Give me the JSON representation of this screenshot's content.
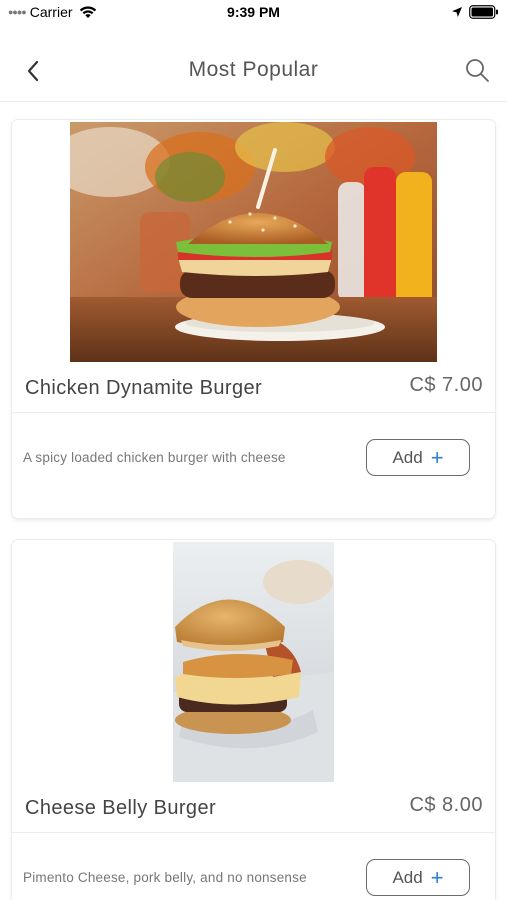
{
  "status_bar": {
    "carrier": "Carrier",
    "time": "9:39 PM",
    "icons": [
      "signal-dots-icon",
      "wifi-icon",
      "location-arrow-icon",
      "battery-icon"
    ]
  },
  "nav": {
    "title": "Most Popular",
    "back_icon": "chevron-left-icon",
    "search_icon": "search-icon"
  },
  "items": [
    {
      "name": "Chicken Dynamite Burger",
      "price": "C$ 7.00",
      "description": "A spicy loaded chicken burger with cheese",
      "add_label": "Add",
      "add_icon": "+"
    },
    {
      "name": "Cheese Belly Burger",
      "price": "C$ 8.00",
      "description": "Pimento Cheese, pork belly, and no nonsense",
      "add_label": "Add",
      "add_icon": "+"
    }
  ],
  "colors": {
    "accent_plus": "#2f7fd0",
    "text_primary": "#444444",
    "text_secondary": "#777777"
  }
}
